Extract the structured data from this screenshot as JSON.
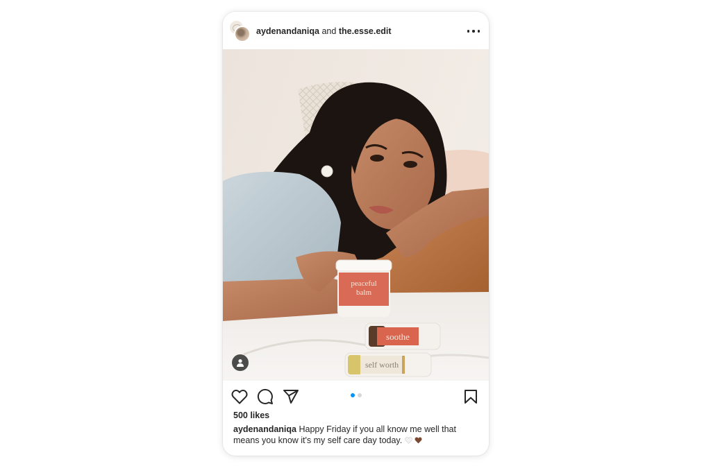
{
  "post": {
    "author": "aydenandaniqa",
    "conjunction": "and",
    "collaborator": "the.esse.edit",
    "likes": "500 likes",
    "caption_user": "aydenandaniqa",
    "caption_text": "Happy Friday if you all know me well that means you know it's my self care day today.",
    "carousel": {
      "count": 2,
      "active_index": 0
    }
  },
  "photo": {
    "jar_label_line1": "peaceful",
    "jar_label_line2": "balm",
    "tube1_label": "soothe",
    "tube2_label": "self worth"
  },
  "colors": {
    "accent_blue": "#0095f6",
    "text": "#262626",
    "heart_white": "#f2f2f2",
    "heart_brown": "#7a4a32"
  },
  "icons": {
    "like": "heart-outline-icon",
    "comment": "comment-bubble-icon",
    "share": "paper-plane-icon",
    "save": "bookmark-icon",
    "more": "ellipsis-icon",
    "tag": "person-tag-icon"
  }
}
